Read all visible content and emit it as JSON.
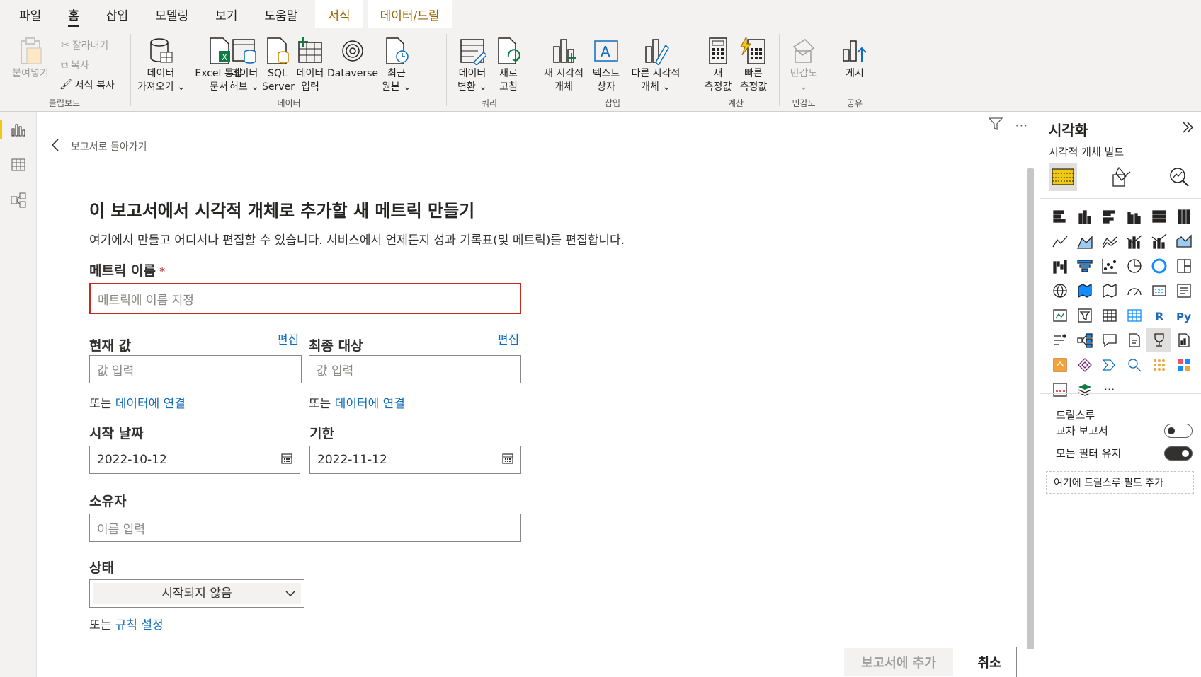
{
  "ribbon_tabs": [
    "파일",
    "홈",
    "삽입",
    "모델링",
    "보기",
    "도움말",
    "서식",
    "데이터/드릴"
  ],
  "clipboard": {
    "paste": "붙여넣기",
    "cut": "잘라내기",
    "copy": "복사",
    "format_painter": "서식 복사",
    "group_label": "클립보드"
  },
  "data_group": {
    "get_data_1": "데이터",
    "get_data_2": "가져오기",
    "excel_1": "Excel 통합",
    "excel_2": "문서",
    "datahub_1": "데이터",
    "datahub_2": "허브",
    "sql_1": "SQL",
    "sql_2": "Server",
    "enter_1": "데이터",
    "enter_2": "입력",
    "dataverse": "Dataverse",
    "recent_1": "최근",
    "recent_2": "원본",
    "group_label": "데이터"
  },
  "query_group": {
    "transform_1": "데이터",
    "transform_2": "변환",
    "refresh_1": "새로",
    "refresh_2": "고침",
    "group_label": "쿼리"
  },
  "insert_group": {
    "newvisual_1": "새 시각적",
    "newvisual_2": "개체",
    "textbox_1": "텍스트",
    "textbox_2": "상자",
    "other_1": "다른 시각적",
    "other_2": "개체",
    "group_label": "삽입"
  },
  "calc_group": {
    "newmeasure_1": "새",
    "newmeasure_2": "측정값",
    "quick_1": "빠른",
    "quick_2": "측정값",
    "group_label": "계산"
  },
  "sensitivity_group": {
    "label": "민감도",
    "group_label": "민감도"
  },
  "share_group": {
    "publish": "게시",
    "group_label": "공유"
  },
  "canvas": {
    "back_text": "보고서로 돌아가기",
    "heading": "이 보고서에서 시각적 개체로 추가할 새 메트릭 만들기",
    "subheading": "여기에서 만들고 어디서나 편집할 수 있습니다. 서비스에서 언제든지 성과 기록표(및 메트릭)를 편집합니다.",
    "metric_name_label": "메트릭 이름",
    "required_mark": "*",
    "metric_name_placeholder": "메트릭에 이름 지정",
    "current_value_label": "현재 값",
    "final_target_label": "최종 대상",
    "edit_link": "편집",
    "value_placeholder": "값 입력",
    "or_text": "또는",
    "connect_data_link": "데이터에 연결",
    "start_date_label": "시작 날짜",
    "start_date_value": "2022-10-12",
    "due_date_label": "기한",
    "due_date_value": "2022-11-12",
    "owner_label": "소유자",
    "owner_placeholder": "이름 입력",
    "status_label": "상태",
    "status_value": "시작되지 않음",
    "rules_link": "규칙 설정",
    "add_button": "보고서에 추가",
    "cancel_button": "취소"
  },
  "viz_pane": {
    "title": "시각화",
    "build_label": "시각적 개체 빌드",
    "more_label": "···",
    "drillthrough_title": "드릴스루",
    "cross_report_label": "교차 보고서",
    "cross_report_on": false,
    "keep_filters_label": "모든 필터 유지",
    "keep_filters_on": true,
    "drop_field_text": "여기에 드릴스루 필드 추가"
  },
  "colors": {
    "accent": "#f2c811",
    "link": "#0f6cbd",
    "error": "#c42b1c",
    "context_tab": "#9c6500"
  }
}
